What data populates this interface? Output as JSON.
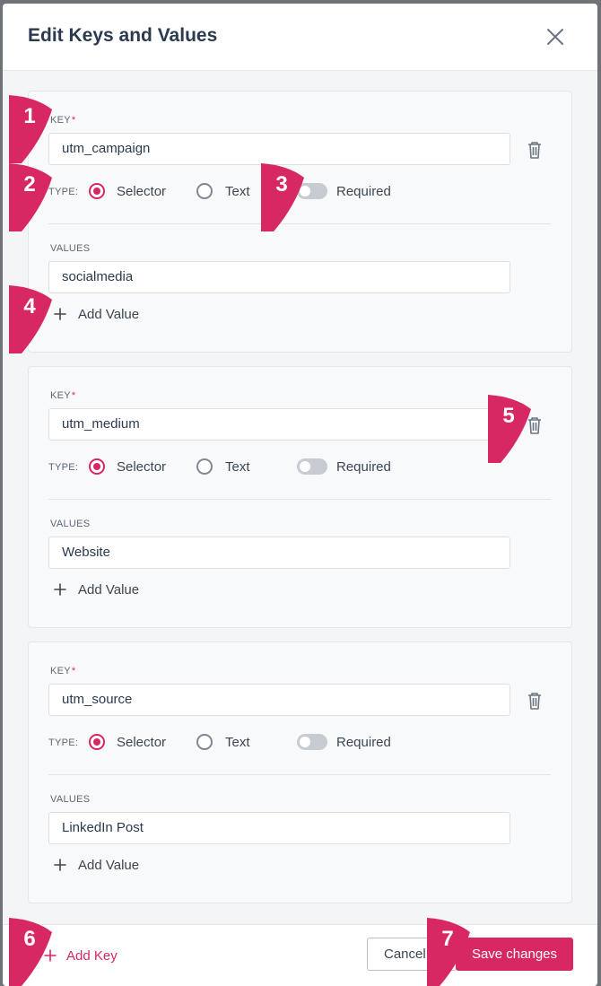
{
  "modal": {
    "title": "Edit Keys and Values"
  },
  "labels": {
    "key": "KEY",
    "required_marker": "*",
    "type": "TYPE:",
    "selector": "Selector",
    "text": "Text",
    "required": "Required",
    "values": "VALUES",
    "add_value": "Add Value"
  },
  "keys": [
    {
      "key": "utm_campaign",
      "type_selected": "Selector",
      "required": false,
      "values": [
        "socialmedia"
      ]
    },
    {
      "key": "utm_medium",
      "type_selected": "Selector",
      "required": false,
      "values": [
        "Website"
      ]
    },
    {
      "key": "utm_source",
      "type_selected": "Selector",
      "required": false,
      "values": [
        "LinkedIn Post"
      ]
    }
  ],
  "footer": {
    "add_key": "Add Key",
    "cancel": "Cancel",
    "save": "Save changes"
  },
  "badges": [
    "1",
    "2",
    "3",
    "4",
    "5",
    "6",
    "7"
  ],
  "colors": {
    "accent": "#d72864",
    "title": "#2b3a4e",
    "toggle_off": "#c7ccd2"
  },
  "icons": {
    "close": "close-icon",
    "delete": "trash-icon",
    "add": "plus-icon"
  }
}
